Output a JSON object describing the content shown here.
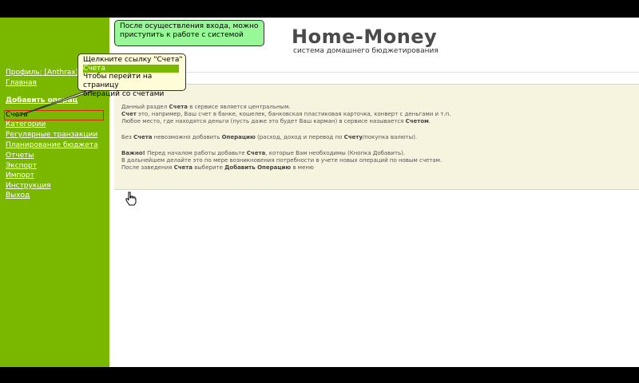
{
  "app": {
    "brand": "Home-Money",
    "tagline": "система домашнего бюджетирования"
  },
  "sidebar": {
    "profile": "Профиль: [Anthrax]",
    "home": "Главная",
    "add_operation": "Добавить операц",
    "items": [
      {
        "label": "Счета"
      },
      {
        "label": "Категории"
      },
      {
        "label": "Регулярные транзакции"
      },
      {
        "label": "Планирование бюджета"
      },
      {
        "label": "Отчеты"
      },
      {
        "label": "Экспорт"
      },
      {
        "label": "Импорт"
      },
      {
        "label": "Инструкция"
      },
      {
        "label": "Выход"
      }
    ]
  },
  "callouts": {
    "top": {
      "line1": "После осуществления входа, можно",
      "line2": "приступить к работе с системой"
    },
    "left": {
      "line1": "Щелкните ссылку \"Счета\"",
      "link": "Счета",
      "line2": "Чтобы перейти на страницу",
      "line3": "операций со счетами"
    }
  },
  "info": {
    "p1": {
      "a": "Данный раздел ",
      "b": "Счета",
      "c": " в сервисе является центральным."
    },
    "p2": {
      "a": "Счет",
      "b": " это, например, Ваш счет в банке, кошелек, банковская пластиковая карточка, конверт с деньгами и т.п."
    },
    "p3": {
      "a": "Любое место, где находятся деньги (пусть даже это будет Ваш карман) в сервисе называется ",
      "b": "Счетом",
      "c": "."
    },
    "p4": {
      "a": "Без ",
      "b": "Счета",
      "c": " невозможно добавить ",
      "d": "Операцию",
      "e": " (расход, доход и перевод по ",
      "f": "Счету",
      "g": "/покупка валюты)."
    },
    "p5": {
      "a": "Важно!",
      "b": " Перед началом работы добавьте ",
      "c": "Счета",
      "d": ", которые Вам необходимы (Кнопка Добавить)."
    },
    "p6": {
      "a": "В дальнейшем делайте это по мере возникновения потребности в учете новых операций по новым счетам."
    },
    "p7": {
      "a": "После заведения ",
      "b": "Счета",
      "c": " выберите ",
      "d": "Добавить Операцию",
      "e": " в меню"
    }
  },
  "colors": {
    "sidebar": "#7ab800",
    "callout_top": "#98f898",
    "callout_left": "#fffcd8",
    "info_panel": "#f6f3de",
    "highlight_border": "#e02020"
  },
  "icons": {
    "cursor": "hand-pointer-icon"
  }
}
